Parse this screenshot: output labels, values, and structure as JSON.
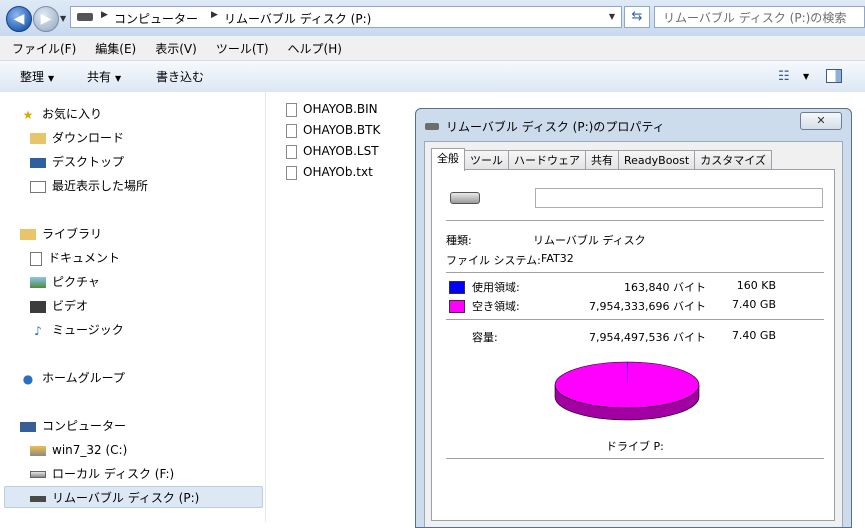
{
  "address": {
    "crumbs": [
      "コンピューター",
      "リムーバブル ディスク (P:)"
    ],
    "search_placeholder": "リムーバブル ディスク (P:)の検索"
  },
  "menu": [
    "ファイル(F)",
    "編集(E)",
    "表示(V)",
    "ツール(T)",
    "ヘルプ(H)"
  ],
  "toolbar": {
    "organize": "整理",
    "share": "共有",
    "burn": "書き込む"
  },
  "nav": {
    "favorites": "お気に入り",
    "downloads": "ダウンロード",
    "desktop": "デスクトップ",
    "recent": "最近表示した場所",
    "libraries": "ライブラリ",
    "documents": "ドキュメント",
    "pictures": "ピクチャ",
    "videos": "ビデオ",
    "music": "ミュージック",
    "homegroup": "ホームグループ",
    "computer": "コンピューター",
    "drive_c": "win7_32 (C:)",
    "drive_f": "ローカル ディスク (F:)",
    "drive_p": "リムーバブル ディスク (P:)"
  },
  "files": [
    "OHAYOB.BIN",
    "OHAYOB.BTK",
    "OHAYOB.LST",
    "OHAYOb.txt"
  ],
  "dialog": {
    "title": "リムーバブル ディスク (P:)のプロパティ",
    "close_label": "✕",
    "tabs": [
      "全般",
      "ツール",
      "ハードウェア",
      "共有",
      "ReadyBoost",
      "カスタマイズ"
    ],
    "label_value": "",
    "type_label": "種類:",
    "type_value": "リムーバブル ディスク",
    "fs_label": "ファイル システム:",
    "fs_value": "FAT32",
    "used_label": "使用領域:",
    "used_bytes": "163,840 バイト",
    "used_size": "160 KB",
    "free_label": "空き領域:",
    "free_bytes": "7,954,333,696 バイト",
    "free_size": "7.40 GB",
    "capacity_label": "容量:",
    "capacity_bytes": "7,954,497,536 バイト",
    "capacity_size": "7.40 GB",
    "drive_caption": "ドライブ P:",
    "used_color": "#0000ff",
    "free_color": "#ff00ff"
  },
  "chart_data": {
    "type": "pie",
    "categories": [
      "使用領域",
      "空き領域"
    ],
    "values": [
      163840,
      7954333696
    ],
    "colors": [
      "#0000ff",
      "#ff00ff"
    ]
  }
}
